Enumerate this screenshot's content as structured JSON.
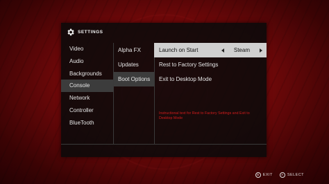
{
  "header": {
    "title": "SETTINGS",
    "icon": "gear-icon"
  },
  "categories": [
    {
      "label": "Video"
    },
    {
      "label": "Audio"
    },
    {
      "label": "Backgrounds"
    },
    {
      "label": "Console"
    },
    {
      "label": "Network"
    },
    {
      "label": "Controller"
    },
    {
      "label": "BlueTooth"
    }
  ],
  "subcategories": [
    {
      "label": "Alpha FX"
    },
    {
      "label": "Updates"
    },
    {
      "label": "Boot Options"
    }
  ],
  "options": {
    "launch_on_start": {
      "label": "Launch on Start",
      "value": "Steam"
    },
    "reset_factory": {
      "label": "Rest to Factory Settings"
    },
    "exit_desktop": {
      "label": "Exit to Desktop Mode"
    }
  },
  "help_text": "Instructional text for Rest to Factory Settings and Exit to Desktop Mode",
  "hints": {
    "exit": {
      "button": "B",
      "label": "EXIT"
    },
    "select": {
      "button": "A",
      "label": "SELECT"
    }
  },
  "colors": {
    "background": "#6e0809",
    "panel": "#0a0a0a",
    "highlight": "#d0d0d0",
    "selected": "#3c3c3c",
    "help_text": "#d21c1c"
  }
}
